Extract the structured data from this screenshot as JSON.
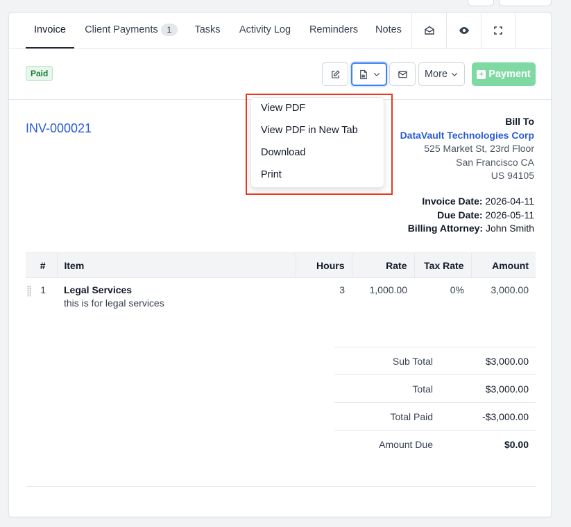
{
  "tabs": [
    {
      "label": "Invoice"
    },
    {
      "label": "Client Payments",
      "count": "1"
    },
    {
      "label": "Tasks"
    },
    {
      "label": "Activity Log"
    },
    {
      "label": "Reminders"
    },
    {
      "label": "Notes"
    }
  ],
  "tab_icons": [
    "mail-open-icon",
    "eye-icon",
    "fullscreen-icon"
  ],
  "status": "Paid",
  "toolbar": {
    "more_label": "More",
    "payment_label": "Payment",
    "plus": "+"
  },
  "invoice": {
    "number": "INV-000021"
  },
  "bill_to": {
    "heading": "Bill To",
    "client": "DataVault Technologies Corp",
    "address1": "525 Market St, 23rd Floor",
    "address2": "San Francisco CA",
    "address3": "US 94105"
  },
  "meta": {
    "invoice_date_label": "Invoice Date:",
    "invoice_date": "2026-04-11",
    "due_date_label": "Due Date:",
    "due_date": "2026-05-11",
    "attorney_label": "Billing Attorney:",
    "attorney": "John Smith"
  },
  "table": {
    "headers": [
      "#",
      "Item",
      "Hours",
      "Rate",
      "Tax Rate",
      "Amount"
    ],
    "rows": [
      {
        "num": "1",
        "item": "Legal Services",
        "desc": "this is for legal services",
        "hours": "3",
        "rate": "1,000.00",
        "tax": "0%",
        "amount": "3,000.00"
      }
    ]
  },
  "totals": {
    "sub_total_label": "Sub Total",
    "sub_total": "$3,000.00",
    "total_label": "Total",
    "total": "$3,000.00",
    "total_paid_label": "Total Paid",
    "total_paid": "-$3,000.00",
    "amount_due_label": "Amount Due",
    "amount_due": "$0.00"
  },
  "pdf_menu": [
    "View PDF",
    "View PDF in New Tab",
    "Download",
    "Print"
  ],
  "colors": {
    "accent": "#2a5bd7",
    "payment": "#7fd9a2",
    "highlight": "#e8391e"
  }
}
